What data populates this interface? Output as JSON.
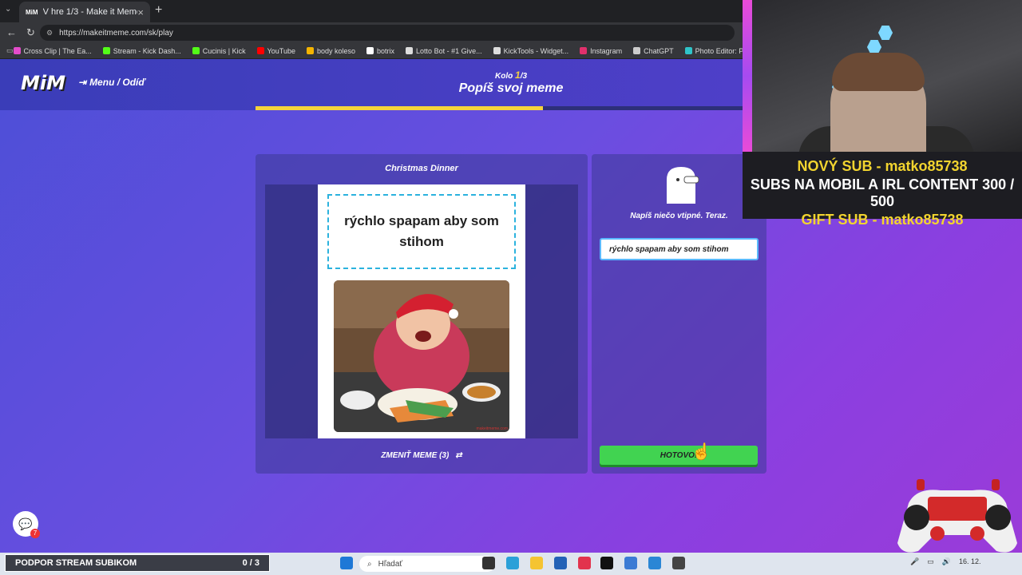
{
  "browser": {
    "tab_title": "V hre 1/3 - Make it Meme",
    "url": "https://makeitmeme.com/sk/play",
    "bookmarks": [
      {
        "label": "Cross Clip | The Ea...",
        "color": "#e44ccb"
      },
      {
        "label": "Stream - Kick Dash...",
        "color": "#53fc18"
      },
      {
        "label": "Cucinis | Kick",
        "color": "#53fc18"
      },
      {
        "label": "YouTube",
        "color": "#ff0000"
      },
      {
        "label": "body koleso",
        "color": "#f4b400"
      },
      {
        "label": "botrix",
        "color": "#ffffff"
      },
      {
        "label": "Lotto Bot - #1 Give...",
        "color": "#dddddd"
      },
      {
        "label": "KickTools - Widget...",
        "color": "#dddddd"
      },
      {
        "label": "Instagram",
        "color": "#e1306c"
      },
      {
        "label": "ChatGPT",
        "color": "#cccccc"
      },
      {
        "label": "Photo Editor: Pixlr...",
        "color": "#2fc4c9"
      }
    ]
  },
  "game": {
    "logo": "MiM",
    "menu_label": "Menu / Odíď",
    "round_prefix": "Kolo",
    "round_current": "1",
    "round_total": "/3",
    "title": "Popíš svoj meme",
    "progress": 0.59,
    "card_title": "Christmas Dinner",
    "caption": "rýchlo spapam aby som stihom",
    "watermark": "makeitmeme.com",
    "change_label": "ZMENIŤ MEME (3)",
    "prompt": "Napíš niečo vtipné. Teraz.",
    "input_value": "rýchlo spapam aby som stihom",
    "done_label": "HOTOVO!"
  },
  "overlay": {
    "line1": "NOVÝ SUB - matko85738",
    "line2": "SUBS NA MOBIL A IRL CONTENT  300 / 500",
    "line3": "GIFT SUB - matko85738"
  },
  "taskbar": {
    "support_label": "PODPOR STREAM SUBIKOM",
    "support_count": "0 / 3",
    "search_placeholder": "Hľadať",
    "date": "16. 12."
  },
  "chat_badge": "7"
}
